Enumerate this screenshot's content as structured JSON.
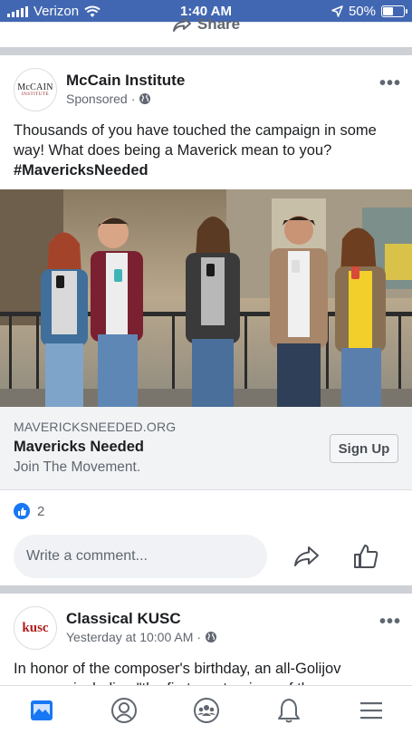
{
  "status_bar": {
    "carrier": "Verizon",
    "time": "1:40 AM",
    "battery_percent": "50%",
    "battery_level": 0.5,
    "signal_icon": "signal-bars-icon",
    "wifi_icon": "wifi-icon",
    "location_icon": "location-arrow-icon"
  },
  "previous_post": {
    "share_label": "Share"
  },
  "post1": {
    "author": "McCain Institute",
    "avatar_line1": "McCAIN",
    "avatar_line2": "INSTITUTE",
    "subtitle": "Sponsored",
    "subtitle_sep": "·",
    "text": "Thousands of you have touched the campaign in some way! What does being a Maverick mean to you?",
    "hashtag": "#MavericksNeeded",
    "link": {
      "domain": "MAVERICKSNEEDED.ORG",
      "title": "Mavericks Needed",
      "description": "Join The Movement.",
      "cta": "Sign Up"
    },
    "reactions_count": "2",
    "comment_placeholder": "Write a comment..."
  },
  "post2": {
    "author": "Classical KUSC",
    "avatar_text": "kusc",
    "subtitle": "Yesterday at 10:00 AM",
    "subtitle_sep": "·",
    "text": "In honor of the composer's birthday, an all-Golijov program including \"the first masterpiece of the new"
  },
  "colors": {
    "facebook_blue": "#4267b2",
    "like_blue": "#1877f2",
    "text_primary": "#1c1e21",
    "text_secondary": "#606770"
  },
  "bottom_nav": [
    "news-feed-icon",
    "profile-icon",
    "groups-icon",
    "notifications-bell-icon",
    "menu-icon"
  ]
}
